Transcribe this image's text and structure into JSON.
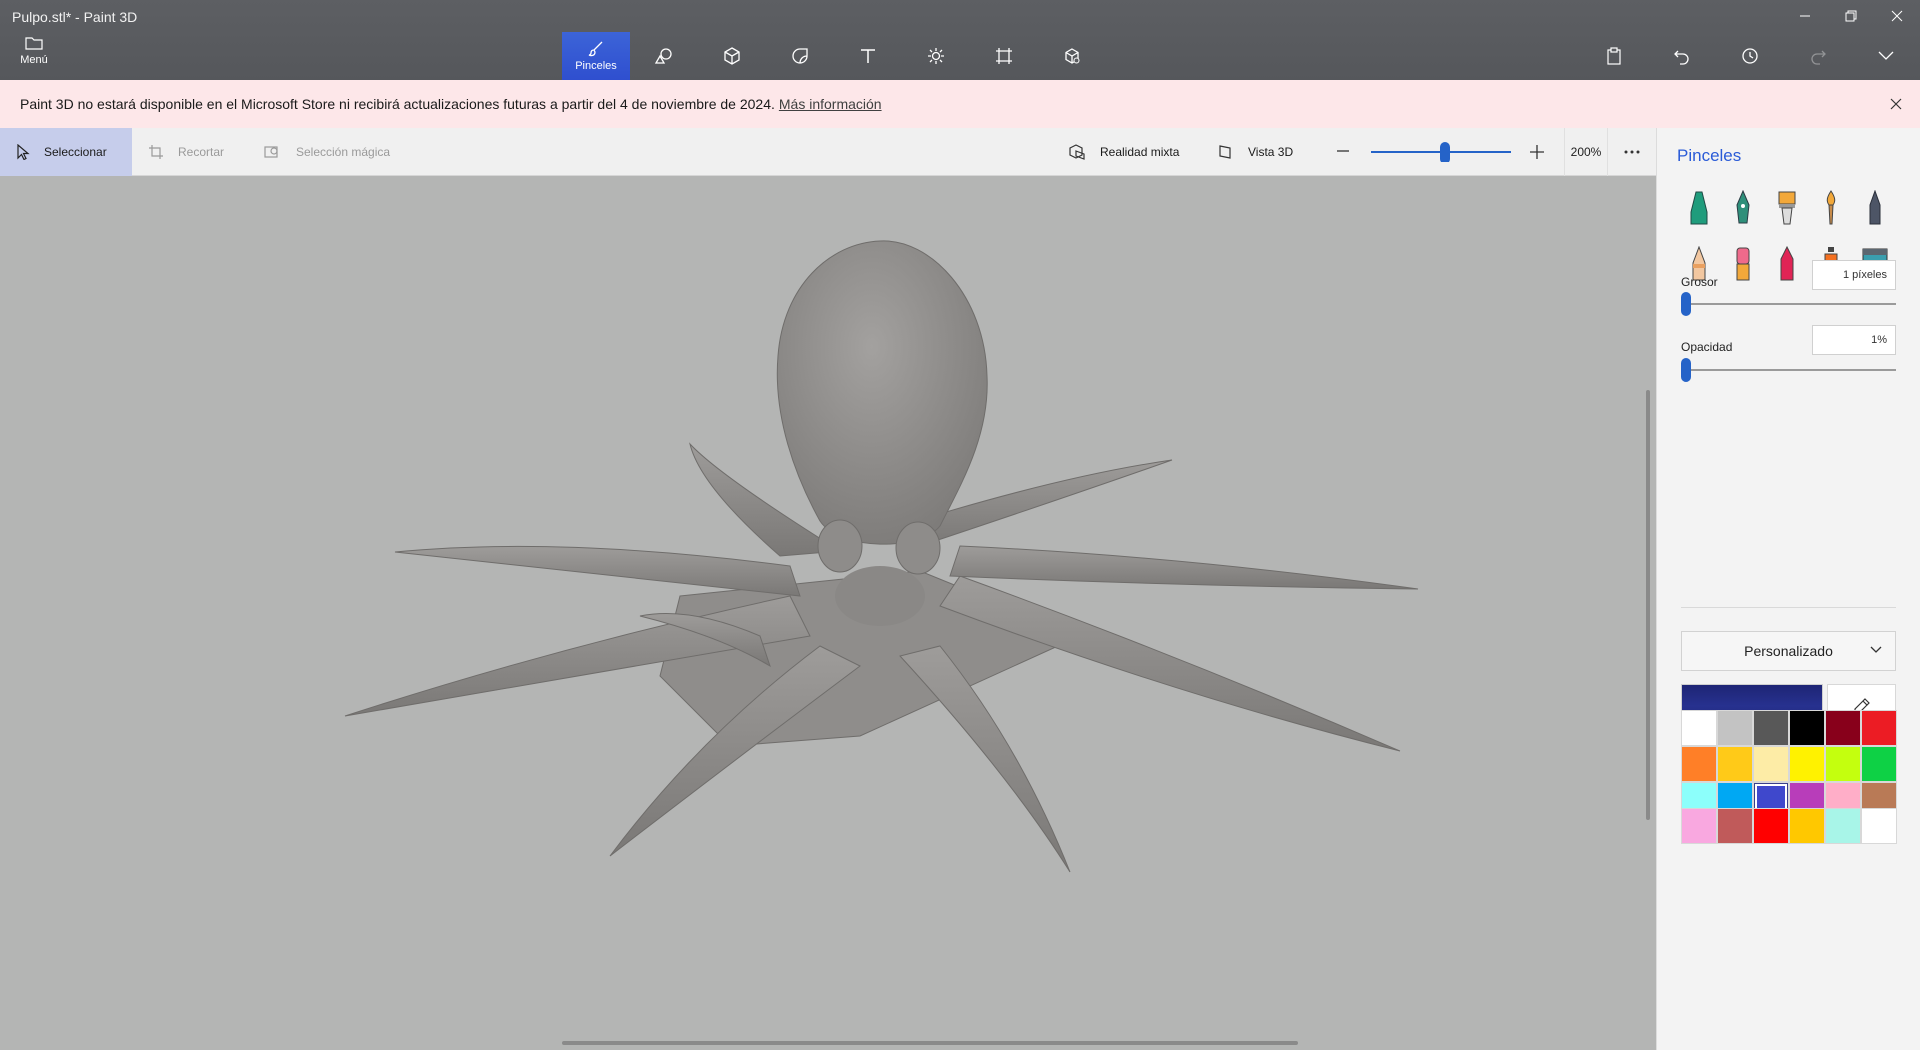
{
  "window": {
    "title": "Pulpo.stl* - Paint 3D",
    "controls": [
      "minimize-icon",
      "restore-icon",
      "close-icon"
    ]
  },
  "menu": {
    "label": "Menú"
  },
  "tools": [
    {
      "id": "brushes",
      "label": "Pinceles",
      "icon": "brush-icon",
      "active": true
    },
    {
      "id": "shapes2d",
      "label": "",
      "icon": "shapes-2d-icon"
    },
    {
      "id": "shapes3d",
      "label": "",
      "icon": "shapes-3d-icon"
    },
    {
      "id": "stickers",
      "label": "",
      "icon": "stickers-icon"
    },
    {
      "id": "text",
      "label": "",
      "icon": "text-icon"
    },
    {
      "id": "effects",
      "label": "",
      "icon": "effects-icon"
    },
    {
      "id": "canvas",
      "label": "",
      "icon": "canvas-icon"
    },
    {
      "id": "library",
      "label": "",
      "icon": "3d-library-icon"
    }
  ],
  "right_commands": [
    "paste-icon",
    "undo-icon",
    "history-icon",
    "redo-icon",
    "expand-icon"
  ],
  "banner": {
    "text": "Paint 3D no estará disponible en el Microsoft Store ni recibirá actualizaciones futuras a partir del 4 de noviembre de 2024.",
    "link": "Más información"
  },
  "subtoolbar": {
    "select": "Seleccionar",
    "crop": "Recortar",
    "magic_select": "Selección mágica",
    "mixed_reality": "Realidad mixta",
    "view3d": "Vista 3D",
    "zoom": "200%",
    "zoom_level": 0.53
  },
  "panel": {
    "title": "Pinceles",
    "brush_tools": [
      "marker-icon",
      "calligraphy-pen-icon",
      "oil-brush-icon",
      "watercolor-icon",
      "pixel-pen-icon",
      "pencil-icon",
      "eraser-icon",
      "crayon-icon",
      "spray-can-icon",
      "fill-bucket-icon"
    ],
    "thickness_label": "Grosor",
    "thickness_value": "1 píxeles",
    "opacity_label": "Opacidad",
    "opacity_value": "1%",
    "palette_mode": "Personalizado",
    "current_color": "#27318f",
    "colors": [
      "#ffffff",
      "#c3c3c3",
      "#585858",
      "#000000",
      "#88001b",
      "#ec1c24",
      "#ff7f27",
      "#ffca18",
      "#fdeca6",
      "#fff200",
      "#c4ff0e",
      "#0ed145",
      "#8cfffb",
      "#00a8f3",
      "#3f48cc",
      "#b83dba",
      "#ffaec8",
      "#b97a56"
    ],
    "selected_color_index": 14,
    "custom_colors": [
      "#f9a8e0",
      "#c05a5a",
      "#ff0000",
      "#ffc800",
      "#a8f5e8",
      "#ffffff"
    ]
  }
}
